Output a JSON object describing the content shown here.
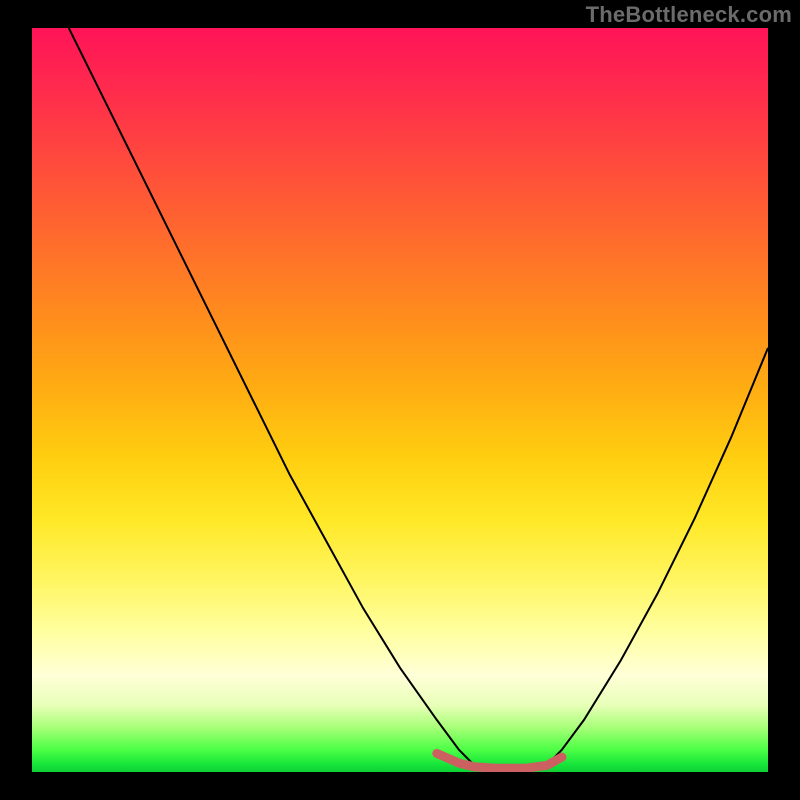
{
  "watermark": "TheBottleneck.com",
  "chart_data": {
    "type": "line",
    "title": "",
    "xlabel": "",
    "ylabel": "",
    "xlim": [
      0,
      100
    ],
    "ylim": [
      0,
      100
    ],
    "gradient_bands": [
      {
        "pos": 0,
        "color": "#ff1458"
      },
      {
        "pos": 18,
        "color": "#ff4a3d"
      },
      {
        "pos": 38,
        "color": "#ff8a1e"
      },
      {
        "pos": 58,
        "color": "#ffcf10"
      },
      {
        "pos": 74,
        "color": "#fff560"
      },
      {
        "pos": 87,
        "color": "#ffffd8"
      },
      {
        "pos": 97,
        "color": "#4cff45"
      },
      {
        "pos": 100,
        "color": "#0fcf36"
      }
    ],
    "series": [
      {
        "name": "bottleneck-curve",
        "stroke": "#000000",
        "stroke_width": 2,
        "x": [
          5,
          10,
          15,
          20,
          25,
          30,
          35,
          40,
          45,
          50,
          55,
          58,
          60,
          63,
          67,
          70,
          72,
          75,
          80,
          85,
          90,
          95,
          100
        ],
        "y": [
          100,
          90,
          80,
          70,
          60,
          50,
          40,
          31,
          22,
          14,
          7,
          3,
          1,
          0,
          0,
          1,
          3,
          7,
          15,
          24,
          34,
          45,
          57
        ]
      },
      {
        "name": "optimal-band",
        "stroke": "#cc6060",
        "stroke_width": 9,
        "linecap": "round",
        "x": [
          55,
          58,
          60,
          63,
          67,
          70,
          72
        ],
        "y": [
          2.5,
          1.2,
          0.7,
          0.5,
          0.5,
          0.9,
          2.0
        ]
      }
    ]
  }
}
